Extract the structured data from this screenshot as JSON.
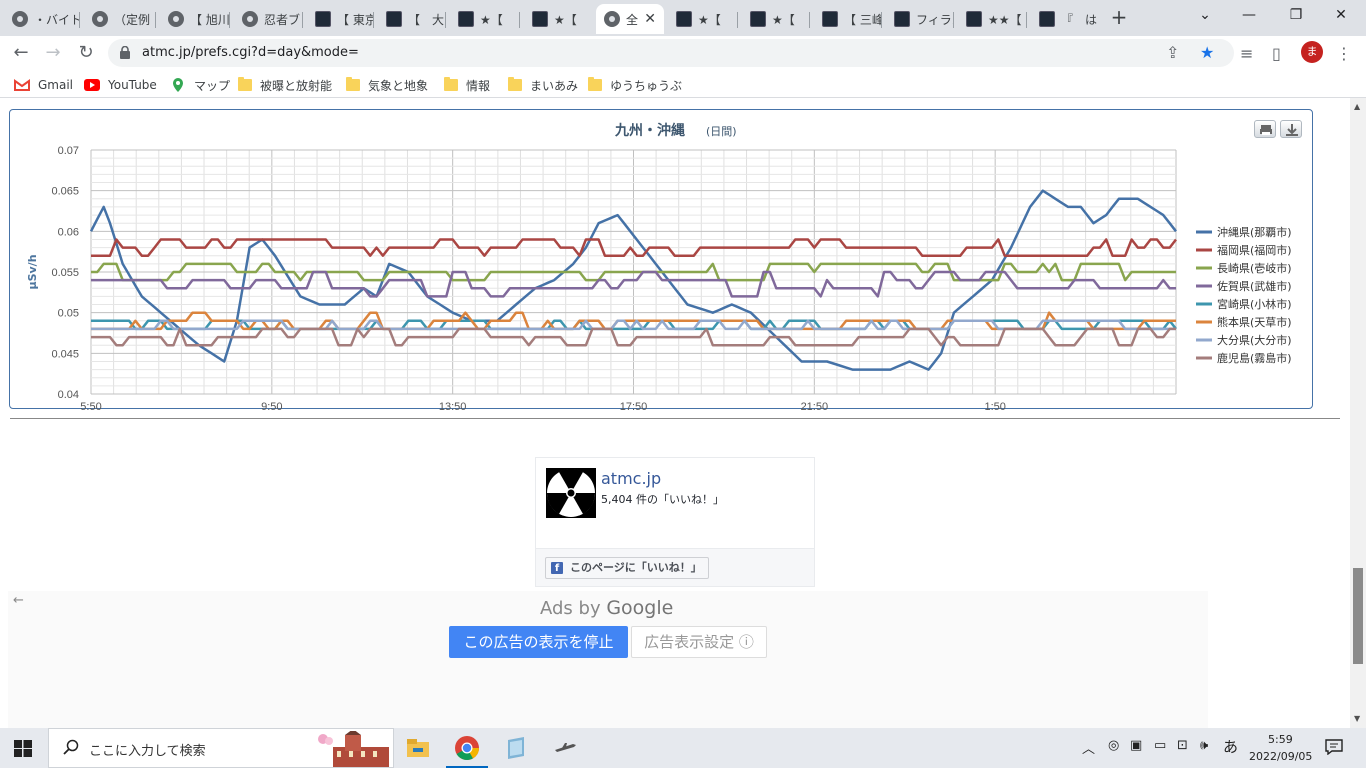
{
  "tabs": [
    {
      "label": "・バイト",
      "icon": "globe-icon"
    },
    {
      "label": "（定例",
      "icon": "globe-icon"
    },
    {
      "label": "【 旭川",
      "icon": "globe-icon"
    },
    {
      "label": "忍者ブ",
      "icon": "globe-icon"
    },
    {
      "label": "【 東京",
      "icon": "site-icon"
    },
    {
      "label": "【　大",
      "icon": "site-icon"
    },
    {
      "label": "★【",
      "icon": "site-icon"
    },
    {
      "label": "★【",
      "icon": "site-icon"
    },
    {
      "label": "全",
      "icon": "globe-icon",
      "active": true
    },
    {
      "label": "★【",
      "icon": "site-icon"
    },
    {
      "label": "★【",
      "icon": "site-icon"
    },
    {
      "label": "【 三峰",
      "icon": "site-icon"
    },
    {
      "label": "フィラメ",
      "icon": "site-icon"
    },
    {
      "label": "★★【",
      "icon": "site-icon"
    },
    {
      "label": "『　は",
      "icon": "site-icon"
    }
  ],
  "toolbar": {
    "url": "atmc.jp/prefs.cgi?d=day&mode=",
    "avatar_letter": "ま"
  },
  "bookmarks": [
    {
      "label": "Gmail",
      "icon": "gmail-icon"
    },
    {
      "label": "YouTube",
      "icon": "youtube-icon"
    },
    {
      "label": "マップ",
      "icon": "maps-icon"
    },
    {
      "label": "被曝と放射能",
      "icon": "folder-icon"
    },
    {
      "label": "気象と地象",
      "icon": "folder-icon"
    },
    {
      "label": "情報",
      "icon": "folder-icon"
    },
    {
      "label": "まいあみ",
      "icon": "folder-icon"
    },
    {
      "label": "ゆうちゅうぶ",
      "icon": "folder-icon"
    }
  ],
  "chart_data": {
    "type": "line",
    "title": "九州・沖縄",
    "subtitle": "(日間)",
    "ylabel": "µSv/h",
    "xlabel": "",
    "ylim": [
      0.04,
      0.07
    ],
    "yticks": [
      "0.07",
      "0.065",
      "0.06",
      "0.055",
      "0.05",
      "0.045",
      "0.04"
    ],
    "xticks": [
      "5:50",
      "9:50",
      "13:50",
      "17:50",
      "21:50",
      "1:50"
    ],
    "grid": true,
    "legend_position": "right",
    "series": [
      {
        "name": "沖縄県(那覇市)",
        "color": "#4572A7",
        "anchors": [
          [
            0,
            0.06
          ],
          [
            2,
            0.063
          ],
          [
            3,
            0.061
          ],
          [
            5,
            0.056
          ],
          [
            8,
            0.052
          ],
          [
            11,
            0.05
          ],
          [
            14,
            0.048
          ],
          [
            17,
            0.046
          ],
          [
            21,
            0.044
          ],
          [
            23,
            0.049
          ],
          [
            25,
            0.058
          ],
          [
            27,
            0.059
          ],
          [
            29,
            0.057
          ],
          [
            33,
            0.052
          ],
          [
            36,
            0.051
          ],
          [
            40,
            0.051
          ],
          [
            43,
            0.053
          ],
          [
            45,
            0.052
          ],
          [
            47,
            0.056
          ],
          [
            50,
            0.055
          ],
          [
            53,
            0.052
          ],
          [
            57,
            0.05
          ],
          [
            60,
            0.049
          ],
          [
            64,
            0.049
          ],
          [
            67,
            0.051
          ],
          [
            70,
            0.053
          ],
          [
            73,
            0.054
          ],
          [
            76,
            0.056
          ],
          [
            78,
            0.058
          ],
          [
            80,
            0.061
          ],
          [
            83,
            0.062
          ],
          [
            85,
            0.06
          ],
          [
            88,
            0.057
          ],
          [
            91,
            0.054
          ],
          [
            94,
            0.051
          ],
          [
            98,
            0.05
          ],
          [
            101,
            0.051
          ],
          [
            104,
            0.05
          ],
          [
            108,
            0.047
          ],
          [
            112,
            0.044
          ],
          [
            116,
            0.044
          ],
          [
            120,
            0.043
          ],
          [
            126,
            0.043
          ],
          [
            129,
            0.044
          ],
          [
            132,
            0.043
          ],
          [
            134,
            0.045
          ],
          [
            136,
            0.05
          ],
          [
            139,
            0.052
          ],
          [
            142,
            0.054
          ],
          [
            145,
            0.058
          ],
          [
            148,
            0.063
          ],
          [
            150,
            0.065
          ],
          [
            152,
            0.064
          ],
          [
            154,
            0.063
          ],
          [
            156,
            0.063
          ],
          [
            158,
            0.061
          ],
          [
            160,
            0.062
          ],
          [
            162,
            0.064
          ],
          [
            165,
            0.064
          ],
          [
            167,
            0.063
          ],
          [
            169,
            0.062
          ],
          [
            171,
            0.06
          ]
        ]
      },
      {
        "name": "福岡県(福岡市)",
        "color": "#AA4643",
        "base": 0.058,
        "amp": 0.001
      },
      {
        "name": "長崎県(壱岐市)",
        "color": "#89A54E",
        "base": 0.055,
        "amp": 0.001
      },
      {
        "name": "佐賀県(武雄市)",
        "color": "#80699B",
        "base": 0.0535,
        "amp": 0.0012
      },
      {
        "name": "宮崎県(小林市)",
        "color": "#3D96AE",
        "base": 0.0485,
        "amp": 0.0006
      },
      {
        "name": "熊本県(天草市)",
        "color": "#DB843D",
        "base": 0.0487,
        "amp": 0.0009
      },
      {
        "name": "大分県(大分市)",
        "color": "#92A8CD",
        "base": 0.0482,
        "amp": 0.0007
      },
      {
        "name": "鹿児島(霧島市)",
        "color": "#A47D7C",
        "base": 0.047,
        "amp": 0.001
      }
    ]
  },
  "fb": {
    "name": "atmc.jp",
    "likes": "5,404 件の「いいね！」",
    "like_button": "このページに「いいね！」",
    "f": "f"
  },
  "ads": {
    "back": "←",
    "ads_by": "Ads by ",
    "google": "Google",
    "stop": "この広告の表示を停止",
    "settings": "広告表示設定 ⓘ"
  },
  "taskbar": {
    "search_placeholder": "ここに入力して検索",
    "time": "5:59",
    "date": "2022/09/05",
    "ime": "あ"
  }
}
